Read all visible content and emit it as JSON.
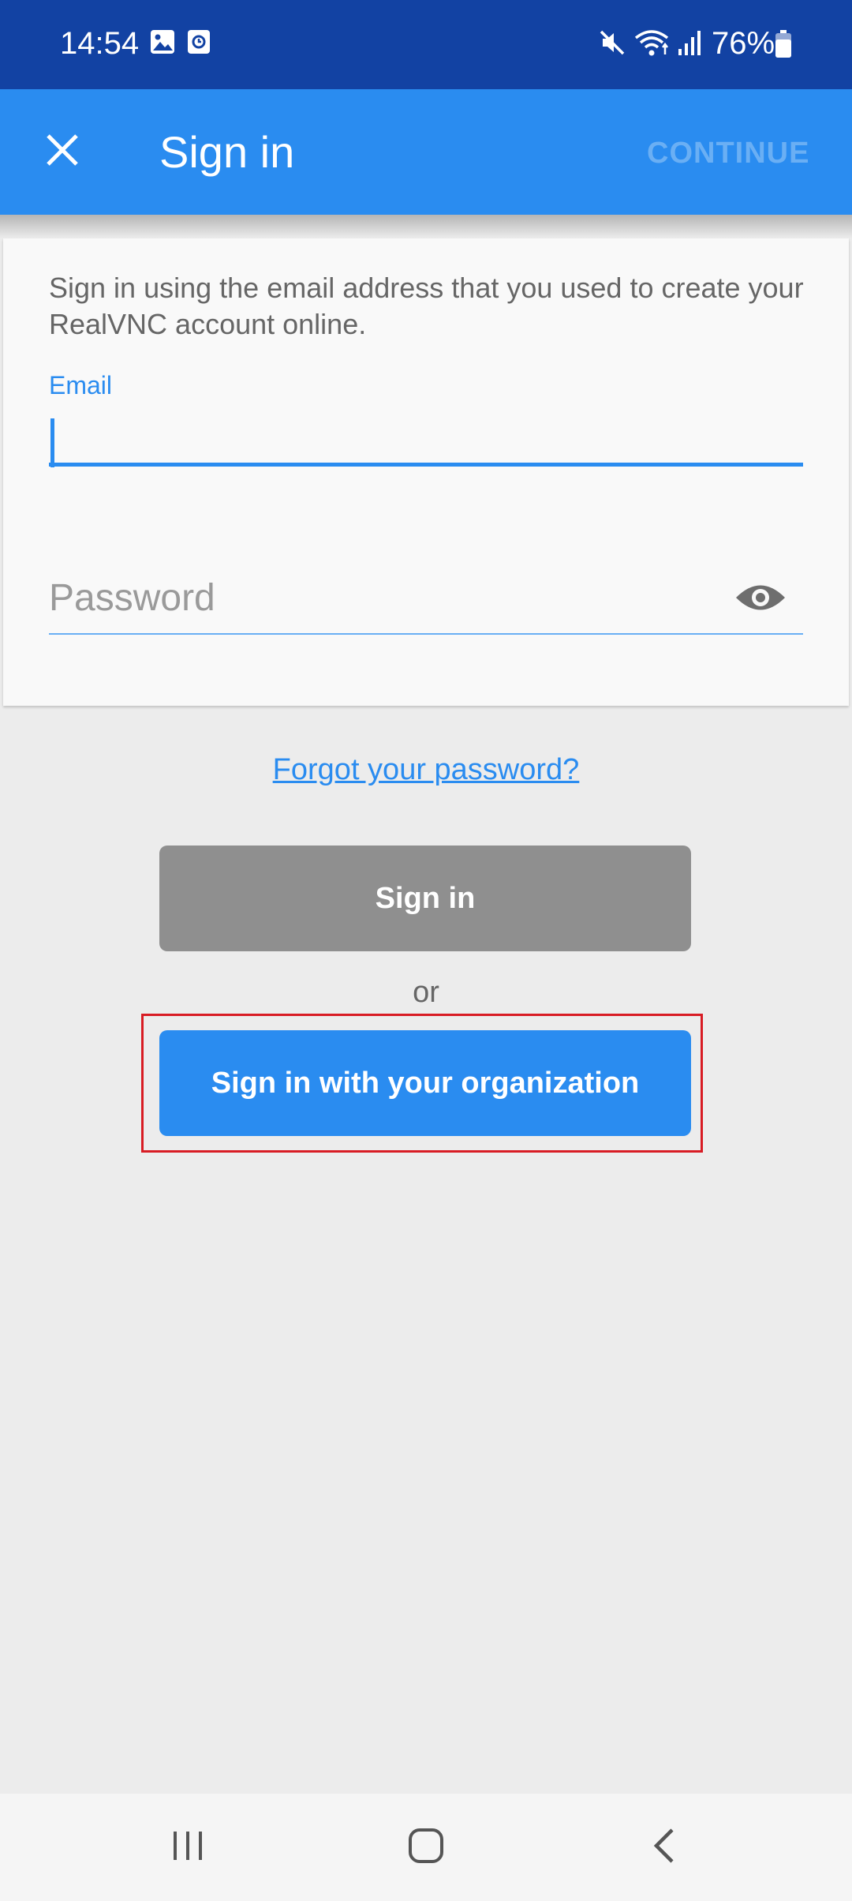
{
  "status_bar": {
    "time": "14:54",
    "battery": "76%",
    "icons": [
      "gallery-icon",
      "screen-record-icon",
      "mute-icon",
      "wifi-icon",
      "signal-icon",
      "battery-icon"
    ]
  },
  "app_bar": {
    "title": "Sign in",
    "close_icon": "close-icon",
    "continue_label": "CONTINUE"
  },
  "form": {
    "intro": "Sign in using the email address that you used to create your RealVNC account online.",
    "email_label": "Email",
    "email_value": "",
    "password_placeholder": "Password",
    "password_value": "",
    "visibility_icon": "eye-icon"
  },
  "links": {
    "forgot_password": "Forgot your password?"
  },
  "buttons": {
    "sign_in": "Sign in",
    "or": "or",
    "sign_in_org": "Sign in with your organization"
  },
  "nav_bar": {
    "icons": [
      "recent-apps-icon",
      "home-icon",
      "back-icon"
    ]
  },
  "colors": {
    "status_bar": "#1242a3",
    "app_bar": "#2a8cf0",
    "accent": "#2a8cf0",
    "disabled_button": "#8f8f8f",
    "highlight": "#d81c24",
    "background": "#ececec"
  }
}
